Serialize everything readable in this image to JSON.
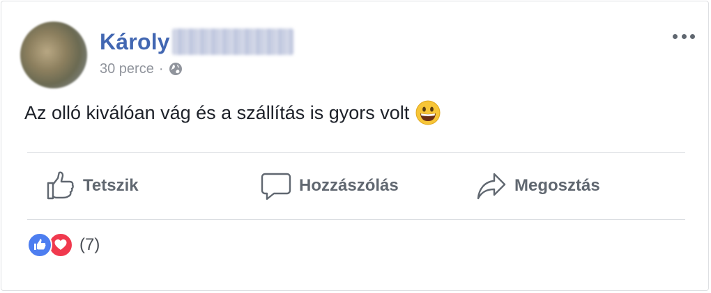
{
  "post": {
    "author_name": "Károly",
    "timestamp": "30 perce",
    "separator": "·",
    "privacy_icon": "globe-icon",
    "text": "Az olló kiválóan vág és a szállítás is gyors volt",
    "emoji_icon": "grinning-face-emoji"
  },
  "actions": {
    "like_label": "Tetszik",
    "comment_label": "Hozzászólás",
    "share_label": "Megosztás"
  },
  "reactions": {
    "icons": [
      "like-reaction-icon",
      "love-reaction-icon"
    ],
    "count_text": "(7)"
  },
  "colors": {
    "name": "#4267b2",
    "secondary_text": "#90949c",
    "action_text": "#606770",
    "like_blue": "#4d7ef0",
    "love_red": "#f0394e"
  }
}
